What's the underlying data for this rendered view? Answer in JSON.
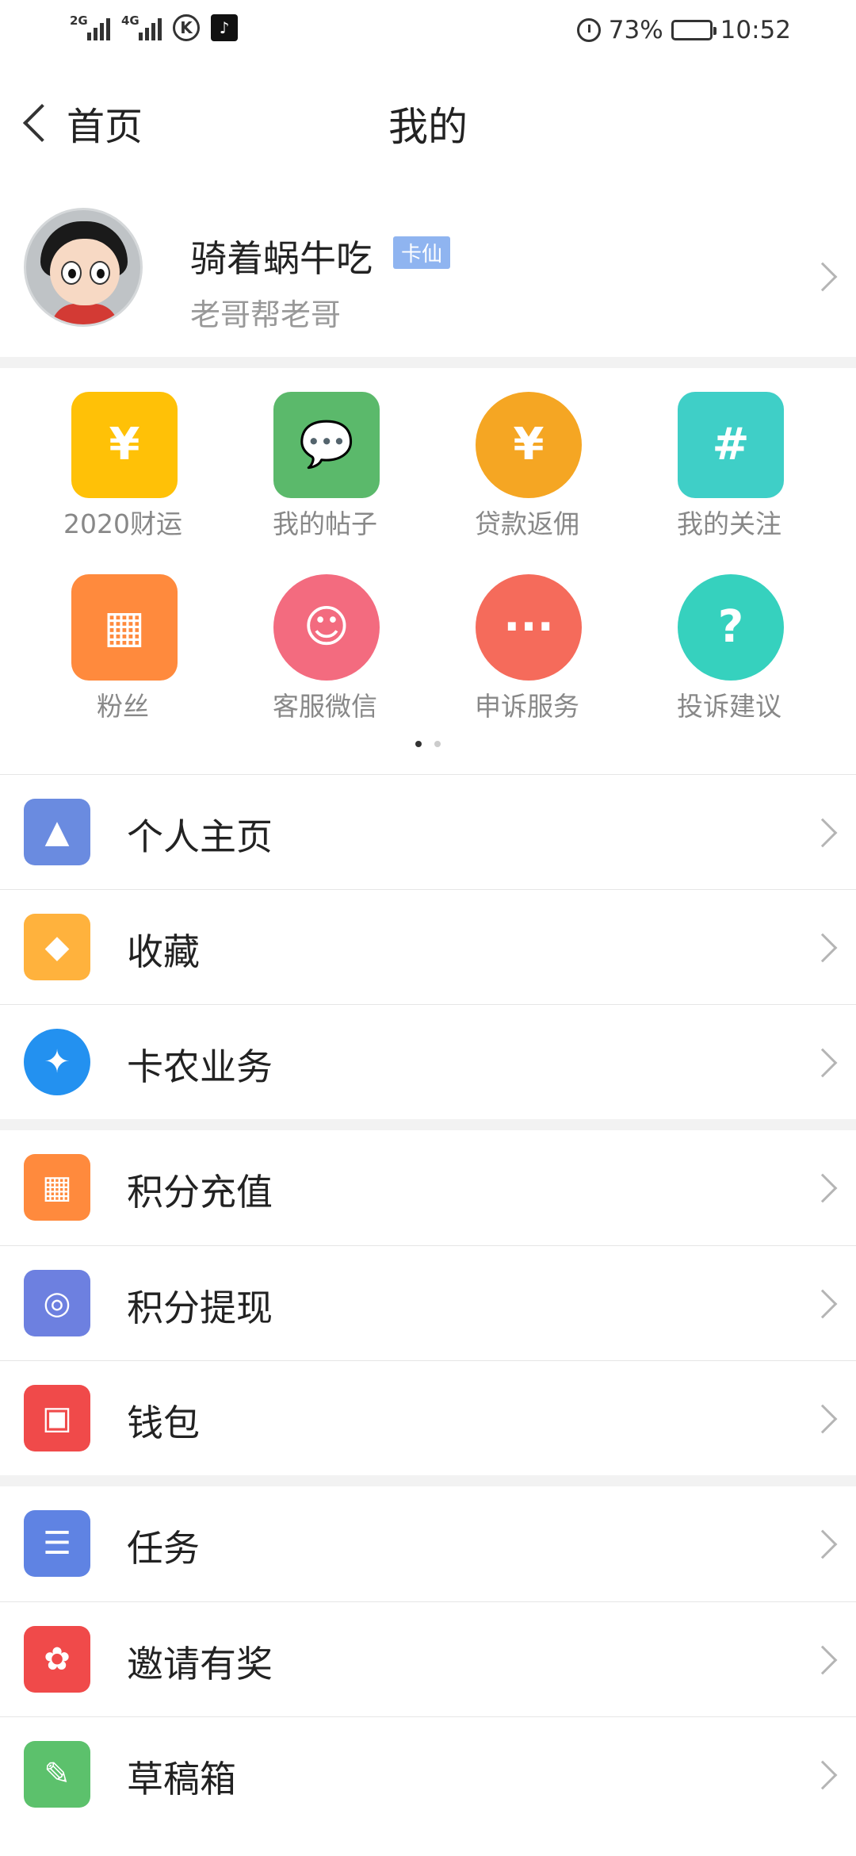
{
  "status_bar": {
    "signal1_type": "2G",
    "signal2_type": "4G",
    "k_app_glyph": "K",
    "tiktok_glyph": "♪",
    "battery_pct": "73%",
    "battery_level": 0.73,
    "time": "10:52"
  },
  "nav": {
    "back_label": "首页",
    "title": "我的"
  },
  "profile": {
    "username": "骑着蜗牛吃",
    "badge": "卡仙",
    "subtitle": "老哥帮老哥"
  },
  "grid": {
    "items": [
      {
        "label": "2020财运",
        "icon": "coins-icon",
        "color": "#FFC107",
        "glyph": "¥"
      },
      {
        "label": "我的帖子",
        "icon": "chat-bubbles-icon",
        "color": "#5BB96B",
        "glyph": "💬"
      },
      {
        "label": "贷款返佣",
        "icon": "yen-coin-icon",
        "color": "#F5A623",
        "glyph": "¥"
      },
      {
        "label": "我的关注",
        "icon": "hashtag-bubble-icon",
        "color": "#3FCFC7",
        "glyph": "#"
      },
      {
        "label": "粉丝",
        "icon": "store-icon",
        "color": "#FF8A3D",
        "glyph": "▦"
      },
      {
        "label": "客服微信",
        "icon": "headset-agent-icon",
        "color": "#F36B7F",
        "glyph": "☺"
      },
      {
        "label": "申诉服务",
        "icon": "message-minus-icon",
        "color": "#F56B5B",
        "glyph": "···"
      },
      {
        "label": "投诉建议",
        "icon": "question-notebook-icon",
        "color": "#36D1BE",
        "glyph": "?"
      }
    ],
    "page_count": 2,
    "active_page": 1
  },
  "list_groups": [
    [
      {
        "label": "个人主页",
        "icon": "picture-icon",
        "color": "#6A8BE0",
        "glyph": "▲"
      },
      {
        "label": "收藏",
        "icon": "cube-icon",
        "color": "#FFB23D",
        "glyph": "◆"
      },
      {
        "label": "卡农业务",
        "icon": "handshake-icon",
        "color": "#2391F0",
        "glyph": "✦"
      }
    ],
    [
      {
        "label": "积分充值",
        "icon": "shop-icon",
        "color": "#FF8A3D",
        "glyph": "▦"
      },
      {
        "label": "积分提现",
        "icon": "spiral-icon",
        "color": "#6D80E0",
        "glyph": "◎"
      },
      {
        "label": "钱包",
        "icon": "wallet-icon",
        "color": "#F04A4A",
        "glyph": "▣"
      }
    ],
    [
      {
        "label": "任务",
        "icon": "checklist-icon",
        "color": "#5F83E3",
        "glyph": "☰"
      },
      {
        "label": "邀请有奖",
        "icon": "gift-bag-icon",
        "color": "#F04A4A",
        "glyph": "✿"
      },
      {
        "label": "草稿箱",
        "icon": "draft-note-icon",
        "color": "#5CC16C",
        "glyph": "✎"
      }
    ]
  ]
}
